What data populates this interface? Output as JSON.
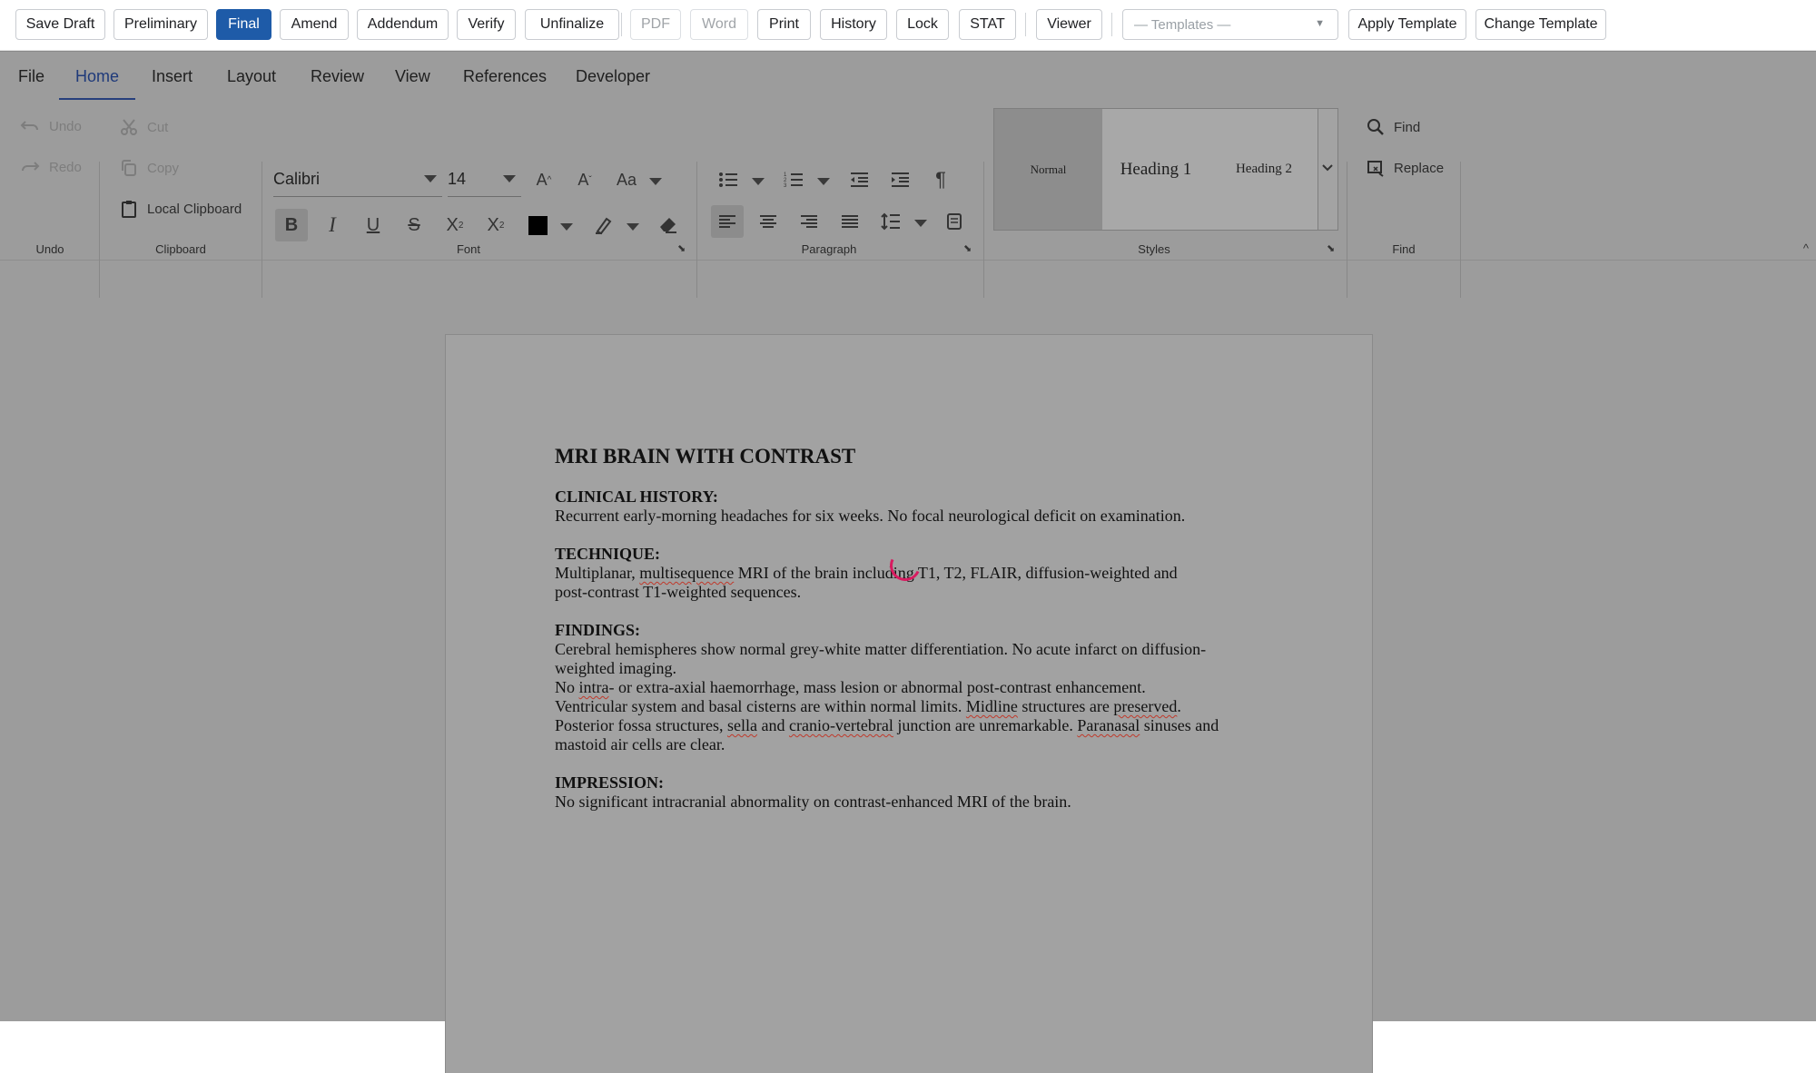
{
  "toolbar": {
    "buttons": {
      "save_draft": "Save Draft",
      "preliminary": "Preliminary",
      "final": "Final",
      "amend": "Amend",
      "addendum": "Addendum",
      "verify": "Verify",
      "unfinalize": "Unfinalize",
      "pdf": "PDF",
      "word": "Word",
      "print": "Print",
      "history": "History",
      "lock": "Lock",
      "stat": "STAT",
      "viewer": "Viewer",
      "apply_template": "Apply Template",
      "change_template": "Change Template"
    },
    "templates_select": "— Templates —",
    "active_status": "Final",
    "accent_color": "#1e5ba8"
  },
  "menu": {
    "items": [
      "File",
      "Home",
      "Insert",
      "Layout",
      "Review",
      "View",
      "References",
      "Developer"
    ],
    "active": "Home"
  },
  "ribbon": {
    "undo": {
      "undo": "Undo",
      "redo": "Redo",
      "group": "Undo"
    },
    "clipboard": {
      "cut": "Cut",
      "copy": "Copy",
      "local": "Local Clipboard",
      "group": "Clipboard"
    },
    "font": {
      "family": "Calibri",
      "size": "14",
      "group": "Font",
      "color": "#000000"
    },
    "paragraph": {
      "group": "Paragraph"
    },
    "styles": {
      "items": [
        "Normal",
        "Heading 1",
        "Heading 2"
      ],
      "selected": "Normal",
      "group": "Styles"
    },
    "find": {
      "find": "Find",
      "replace": "Replace",
      "group": "Find"
    }
  },
  "document": {
    "title": "MRI BRAIN WITH CONTRAST",
    "clinical_history_heading": "CLINICAL HISTORY:",
    "clinical_history": "Recurrent early-morning headaches for six weeks. No focal neurological deficit on examination.",
    "technique_heading": "TECHNIQUE:",
    "technique_pre": "Multiplanar, ",
    "technique_sp": "multisequence",
    "technique_post": " MRI of the brain including T1, T2, FLAIR, diffusion-weighted and",
    "technique_line2": "post-contrast T1-weighted sequences.",
    "findings_heading": "FINDINGS:",
    "findings_l1": "Cerebral hemispheres show normal grey-white matter differentiation. No acute infarct on diffusion-",
    "findings_l2": "weighted imaging.",
    "findings_l3_pre": "No ",
    "findings_l3_sp": "intra",
    "findings_l3_post": "- or extra-axial haemorrhage, mass lesion or abnormal post-contrast enhancement.",
    "findings_l4_pre": "Ventricular system and basal cisterns are within normal limits. ",
    "findings_l4_sp1": "Midline",
    "findings_l4_mid": " structures are ",
    "findings_l4_sp2": "preserved",
    "findings_l4_post": ".",
    "findings_l5_pre": "Posterior fossa structures, ",
    "findings_l5_sp1": "sella",
    "findings_l5_mid1": " and ",
    "findings_l5_sp2": "cranio-vertebral",
    "findings_l5_mid2": " junction are unremarkable. ",
    "findings_l5_sp3": "Paranasal",
    "findings_l5_post": " sinuses and",
    "findings_l6": "mastoid air cells are clear.",
    "impression_heading": "IMPRESSION:",
    "impression": "No significant intracranial abnormality on contrast-enhanced MRI of the brain."
  }
}
